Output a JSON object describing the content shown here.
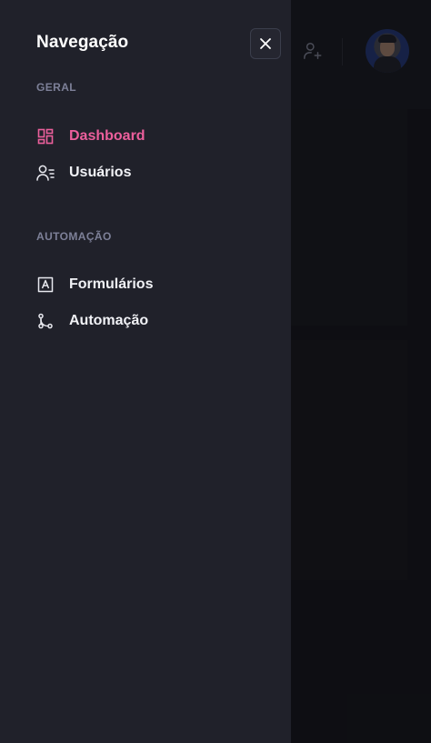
{
  "drawer": {
    "title": "Navegação",
    "close_icon": "close-icon",
    "sections": [
      {
        "label": "GERAL",
        "items": [
          {
            "label": "Dashboard",
            "icon": "dashboard-icon",
            "active": true
          },
          {
            "label": "Usuários",
            "icon": "users-list-icon",
            "active": false
          }
        ]
      },
      {
        "label": "AUTOMAÇÃO",
        "items": [
          {
            "label": "Formulários",
            "icon": "form-icon",
            "active": false
          },
          {
            "label": "Automação",
            "icon": "git-branch-icon",
            "active": false
          }
        ]
      }
    ]
  },
  "header": {
    "add_user_icon": "add-user-icon",
    "avatar": "user-avatar"
  },
  "colors": {
    "accent": "#ec5f9c",
    "drawer_bg": "#20212a",
    "page_bg": "#111217",
    "section_label": "#7d8098"
  }
}
